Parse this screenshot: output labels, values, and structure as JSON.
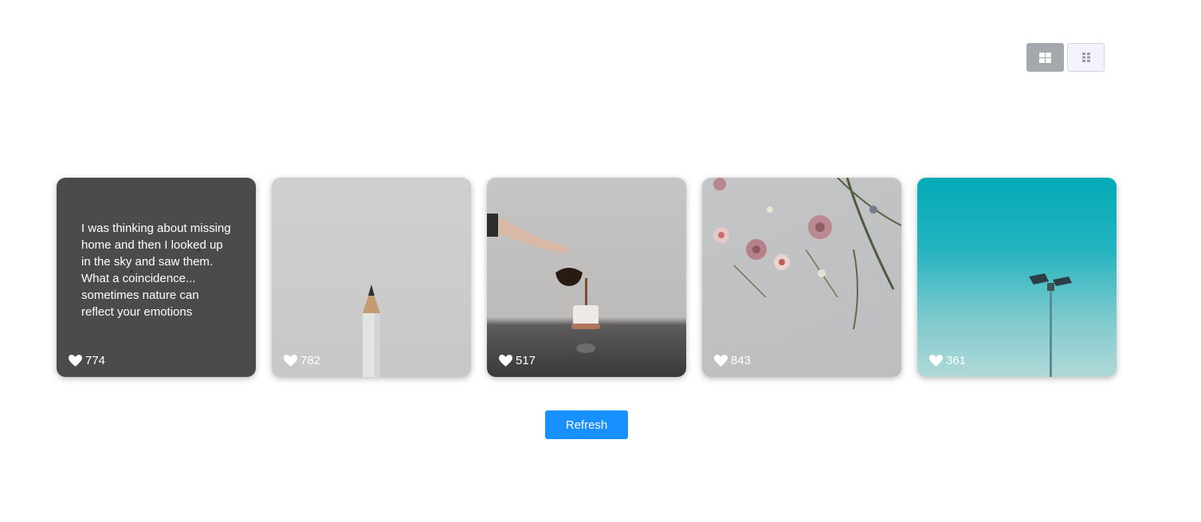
{
  "view_toggle": {
    "active_icon": "grid-large-icon",
    "inactive_icon": "grid-small-icon",
    "active_color": "#a4a9ad"
  },
  "cards": [
    {
      "caption": "I was thinking about missing home and then I looked up in the sky and saw them. What a coincidence... sometimes nature can reflect your emotions",
      "likes": "774",
      "image": "night-sky-birds"
    },
    {
      "caption": "",
      "likes": "782",
      "image": "pencil"
    },
    {
      "caption": "",
      "likes": "517",
      "image": "coffee-pour"
    },
    {
      "caption": "",
      "likes": "843",
      "image": "flowers"
    },
    {
      "caption": "",
      "likes": "361",
      "image": "lamp-post-sky"
    }
  ],
  "refresh_label": "Refresh",
  "colors": {
    "accent": "#1890ff",
    "card_text": "#ffffff"
  }
}
